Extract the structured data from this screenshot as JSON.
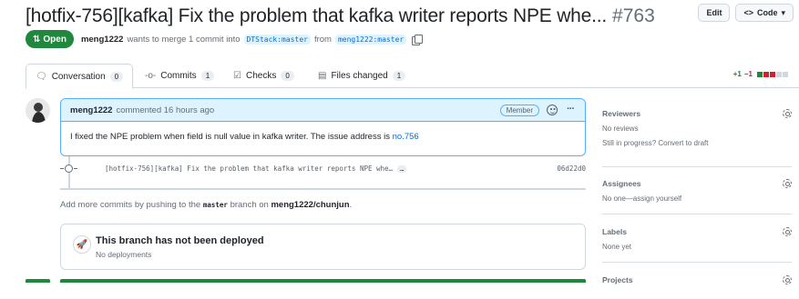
{
  "header": {
    "title": "[hotfix-756][kafka] Fix the problem that kafka writer reports NPE whe...",
    "number": "#763",
    "edit_label": "Edit",
    "code_label": "Code"
  },
  "meta": {
    "state": "Open",
    "author": "meng1222",
    "merge_text_1": "wants to merge 1 commit into",
    "base_branch": "DTStack:master",
    "merge_text_2": "from",
    "head_branch": "meng1222:master"
  },
  "tabs": [
    {
      "label": "Conversation",
      "count": "0",
      "icon": "conversation-icon"
    },
    {
      "label": "Commits",
      "count": "1",
      "icon": "commit-icon"
    },
    {
      "label": "Checks",
      "count": "0",
      "icon": "checklist-icon"
    },
    {
      "label": "Files changed",
      "count": "1",
      "icon": "file-diff-icon"
    }
  ],
  "diffstat": {
    "additions": "+1",
    "deletions": "−1",
    "blocks": [
      "#1f883d",
      "#cf222e",
      "#cf222e",
      "#d0d7de",
      "#d0d7de"
    ]
  },
  "comment": {
    "author": "meng1222",
    "time_text": "commented 16 hours ago",
    "badge": "Member",
    "body_text": "I fixed the NPE problem when field is null value in kafka writer. The issue address is",
    "link_text": "no.756"
  },
  "commit": {
    "message": "[hotfix-756][kafka] Fix the problem that kafka writer reports NPE whe…",
    "more_label": "…",
    "sha": "06d22d0"
  },
  "push_hint": {
    "text_1": "Add more commits by pushing to the",
    "branch": "master",
    "text_2": "branch on",
    "repo": "meng1222/chunjun",
    "text_3": "."
  },
  "deploy": {
    "title": "This branch has not been deployed",
    "subtitle": "No deployments"
  },
  "sidebar": {
    "reviewers": {
      "title": "Reviewers",
      "line1": "No reviews",
      "line2": "Still in progress? Convert to draft"
    },
    "assignees": {
      "title": "Assignees",
      "line1": "No one—assign yourself"
    },
    "labels": {
      "title": "Labels",
      "line1": "None yet"
    },
    "projects": {
      "title": "Projects"
    }
  },
  "colors": {
    "accent_green": "#1f883d",
    "link_blue": "#0969da",
    "comment_header": "#ddf4ff"
  }
}
